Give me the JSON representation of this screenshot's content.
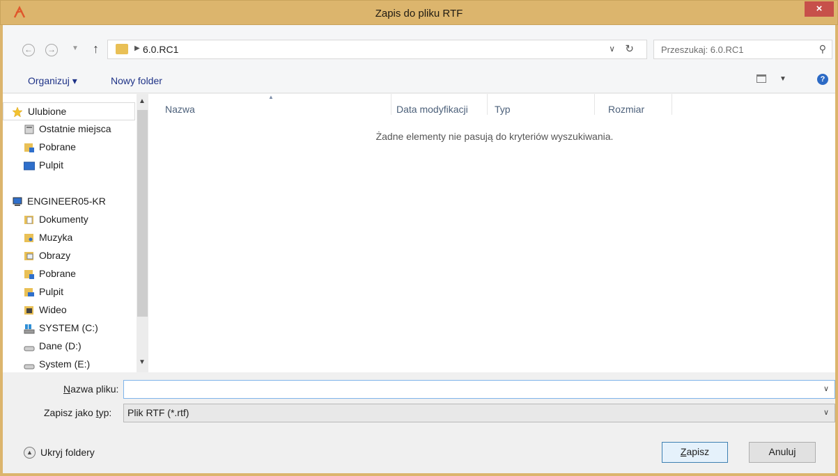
{
  "window": {
    "title": "Zapis do pliku RTF",
    "close_glyph": "×"
  },
  "nav": {
    "back_glyph": "←",
    "forward_glyph": "→",
    "up_glyph": "↑",
    "path": "6.0.RC1",
    "search_placeholder": "Przeszukaj: 6.0.RC1"
  },
  "toolbar": {
    "organize_label": "Organizuj ▾",
    "new_folder_label": "Nowy folder",
    "help_glyph": "?"
  },
  "sidebar": {
    "items": [
      {
        "label": "Ulubione",
        "icon": "star-icon"
      },
      {
        "label": "Ostatnie miejsca",
        "icon": "recent-places-icon"
      },
      {
        "label": "Pobrane",
        "icon": "downloads-folder-icon"
      },
      {
        "label": "Pulpit",
        "icon": "desktop-icon"
      },
      {
        "label": "ENGINEER05-KR",
        "icon": "computer-icon"
      },
      {
        "label": "Dokumenty",
        "icon": "documents-folder-icon"
      },
      {
        "label": "Muzyka",
        "icon": "music-folder-icon"
      },
      {
        "label": "Obrazy",
        "icon": "pictures-folder-icon"
      },
      {
        "label": "Pobrane",
        "icon": "downloads-folder-icon"
      },
      {
        "label": "Pulpit",
        "icon": "desktop-folder-icon"
      },
      {
        "label": "Wideo",
        "icon": "video-folder-icon"
      },
      {
        "label": "SYSTEM (C:)",
        "icon": "system-drive-icon"
      },
      {
        "label": "Dane (D:)",
        "icon": "drive-icon"
      },
      {
        "label": "System (E:)",
        "icon": "drive-icon"
      }
    ]
  },
  "columns": {
    "name": "Nazwa",
    "modified": "Data modyfikacji",
    "type": "Typ",
    "size": "Rozmiar"
  },
  "content": {
    "empty_message": "Żadne elementy nie pasują do kryteriów wyszukiwania."
  },
  "form": {
    "filename_label_u": "N",
    "filename_label_rest": "azwa pliku:",
    "filename_value": "",
    "filetype_label_pre": "Zapisz jako ",
    "filetype_label_u": "t",
    "filetype_label_post": "yp:",
    "filetype_value": "Plik RTF (*.rtf)"
  },
  "footer": {
    "hide_folders_label": "Ukryj foldery",
    "save_label_u": "Z",
    "save_label_rest": "apisz",
    "cancel_label": "Anuluj"
  },
  "colors": {
    "title_bar": "#dcb56d",
    "close_button": "#c7504a",
    "link_text": "#1e3287"
  }
}
